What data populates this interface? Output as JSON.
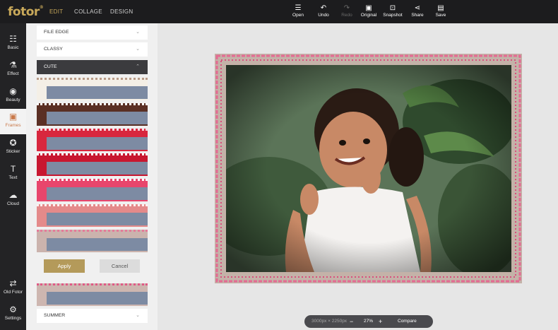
{
  "brand": {
    "logo_text": "fotor",
    "logo_mark": "®"
  },
  "nav": {
    "edit": "EDIT",
    "collage": "COLLAGE",
    "design": "DESIGN"
  },
  "toolbar": [
    {
      "label": "Open",
      "icon": "menu-icon",
      "glyph": "☰",
      "disabled": false
    },
    {
      "label": "Undo",
      "icon": "undo-icon",
      "glyph": "↶",
      "disabled": false
    },
    {
      "label": "Redo",
      "icon": "redo-icon",
      "glyph": "↷",
      "disabled": true
    },
    {
      "label": "Original",
      "icon": "original-icon",
      "glyph": "▣",
      "disabled": false
    },
    {
      "label": "Snapshot",
      "icon": "snapshot-icon",
      "glyph": "⊡",
      "disabled": false
    },
    {
      "label": "Share",
      "icon": "share-icon",
      "glyph": "⋖",
      "disabled": false
    },
    {
      "label": "Save",
      "icon": "save-icon",
      "glyph": "▤",
      "disabled": false
    }
  ],
  "sidebar": [
    {
      "label": "Basic",
      "icon": "sliders-icon",
      "glyph": "☷"
    },
    {
      "label": "Effect",
      "icon": "flask-icon",
      "glyph": "⚗"
    },
    {
      "label": "Beauty",
      "icon": "eye-icon",
      "glyph": "◉"
    },
    {
      "label": "Frames",
      "icon": "frame-icon",
      "glyph": "▣",
      "active": true
    },
    {
      "label": "Sticker",
      "icon": "sticker-icon",
      "glyph": "✪"
    },
    {
      "label": "Text",
      "icon": "text-icon",
      "glyph": "T"
    },
    {
      "label": "Cloud",
      "icon": "cloud-icon",
      "glyph": "☁"
    },
    {
      "label": "Old Fotor",
      "icon": "switch-icon",
      "glyph": "⇄"
    },
    {
      "label": "Settings",
      "icon": "gear-icon",
      "glyph": "⚙"
    }
  ],
  "panel": {
    "categories": {
      "file_edge": "FILE EDGE",
      "classy": "CLASSY",
      "cute": "CUTE",
      "summer": "SUMMER"
    },
    "frames": [
      {
        "name": "lace-white",
        "bg": "#f4efe6",
        "edge": "#b89a88"
      },
      {
        "name": "brown-dots",
        "bg": "#5a2f24",
        "edge": "#ffffff"
      },
      {
        "name": "red-polka",
        "bg": "#d8273e",
        "edge": "#f7d9df"
      },
      {
        "name": "red-scallop",
        "bg": "#c81730",
        "edge": "#ffffff"
      },
      {
        "name": "pink-wave",
        "bg": "#e8466c",
        "edge": "#ffffff"
      },
      {
        "name": "salmon-lace",
        "bg": "#e48a8a",
        "edge": "#fff0f0"
      },
      {
        "name": "pink-border",
        "bg": "#cbb3ad",
        "edge": "#e6799a"
      },
      {
        "name": "pink-scallop-bottom",
        "bg": "#cdb6b0",
        "edge": "#e05a86"
      }
    ],
    "apply_label": "Apply",
    "cancel_label": "Cancel"
  },
  "status": {
    "dimensions": "3000px × 2250px",
    "zoom_out": "−",
    "zoom": "27%",
    "zoom_in": "+",
    "compare": "Compare"
  }
}
